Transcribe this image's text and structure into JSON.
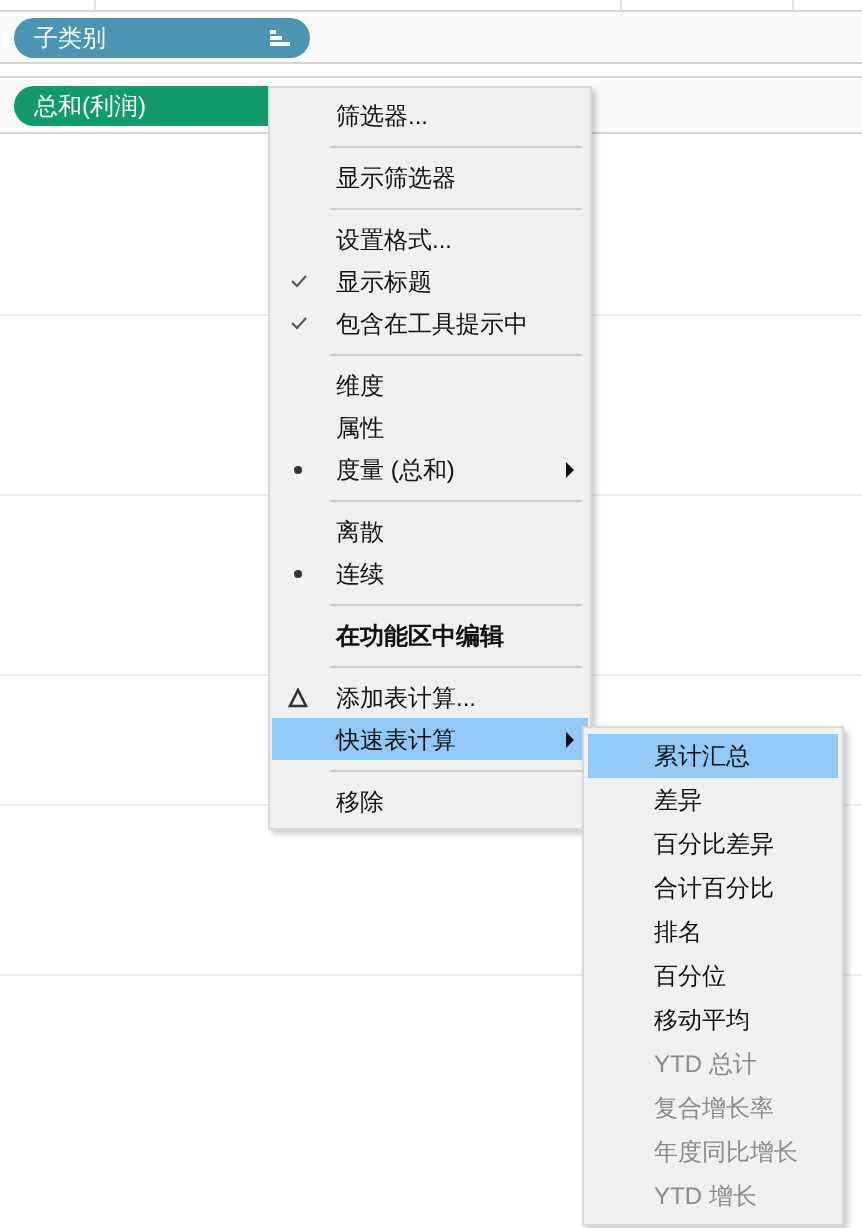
{
  "shelves": [
    {
      "label": "子类别",
      "color": "#4b94b3",
      "sorted": true
    },
    {
      "label": "总和(利润)",
      "color": "#119a6b",
      "sorted": false
    }
  ],
  "context_menu": {
    "items": [
      {
        "kind": "command",
        "label": "筛选器...",
        "submenu": false,
        "bold": false,
        "selected": false
      },
      {
        "kind": "separator"
      },
      {
        "kind": "command",
        "label": "显示筛选器",
        "submenu": false,
        "bold": false,
        "selected": false
      },
      {
        "kind": "separator"
      },
      {
        "kind": "command",
        "label": "设置格式...",
        "submenu": false,
        "bold": false,
        "selected": false
      },
      {
        "kind": "check",
        "label": "显示标题",
        "checked": true,
        "submenu": false,
        "bold": false,
        "selected": false
      },
      {
        "kind": "check",
        "label": "包含在工具提示中",
        "checked": true,
        "submenu": false,
        "bold": false,
        "selected": false
      },
      {
        "kind": "separator"
      },
      {
        "kind": "radio",
        "label": "维度",
        "checked": false,
        "submenu": false,
        "bold": false,
        "selected": false
      },
      {
        "kind": "radio",
        "label": "属性",
        "checked": false,
        "submenu": false,
        "bold": false,
        "selected": false
      },
      {
        "kind": "radio",
        "label": "度量 (总和)",
        "checked": true,
        "submenu": true,
        "bold": false,
        "selected": false
      },
      {
        "kind": "separator"
      },
      {
        "kind": "radio",
        "label": "离散",
        "checked": false,
        "submenu": false,
        "bold": false,
        "selected": false
      },
      {
        "kind": "radio",
        "label": "连续",
        "checked": true,
        "submenu": false,
        "bold": false,
        "selected": false
      },
      {
        "kind": "separator"
      },
      {
        "kind": "command",
        "label": "在功能区中编辑",
        "submenu": false,
        "bold": true,
        "selected": false
      },
      {
        "kind": "separator"
      },
      {
        "kind": "calc",
        "label": "添加表计算...",
        "submenu": false,
        "bold": false,
        "selected": false
      },
      {
        "kind": "command",
        "label": "快速表计算",
        "submenu": true,
        "bold": false,
        "selected": true
      },
      {
        "kind": "separator"
      },
      {
        "kind": "command",
        "label": "移除",
        "submenu": false,
        "bold": false,
        "selected": false
      }
    ]
  },
  "submenu": {
    "items": [
      {
        "label": "累计汇总",
        "selected": true,
        "disabled": false
      },
      {
        "label": "差异",
        "selected": false,
        "disabled": false
      },
      {
        "label": "百分比差异",
        "selected": false,
        "disabled": false
      },
      {
        "label": "合计百分比",
        "selected": false,
        "disabled": false
      },
      {
        "label": "排名",
        "selected": false,
        "disabled": false
      },
      {
        "label": "百分位",
        "selected": false,
        "disabled": false
      },
      {
        "label": "移动平均",
        "selected": false,
        "disabled": false
      },
      {
        "label": "YTD 总计",
        "selected": false,
        "disabled": true
      },
      {
        "label": "复合增长率",
        "selected": false,
        "disabled": true
      },
      {
        "label": "年度同比增长",
        "selected": false,
        "disabled": true
      },
      {
        "label": "YTD 增长",
        "selected": false,
        "disabled": true
      }
    ]
  }
}
